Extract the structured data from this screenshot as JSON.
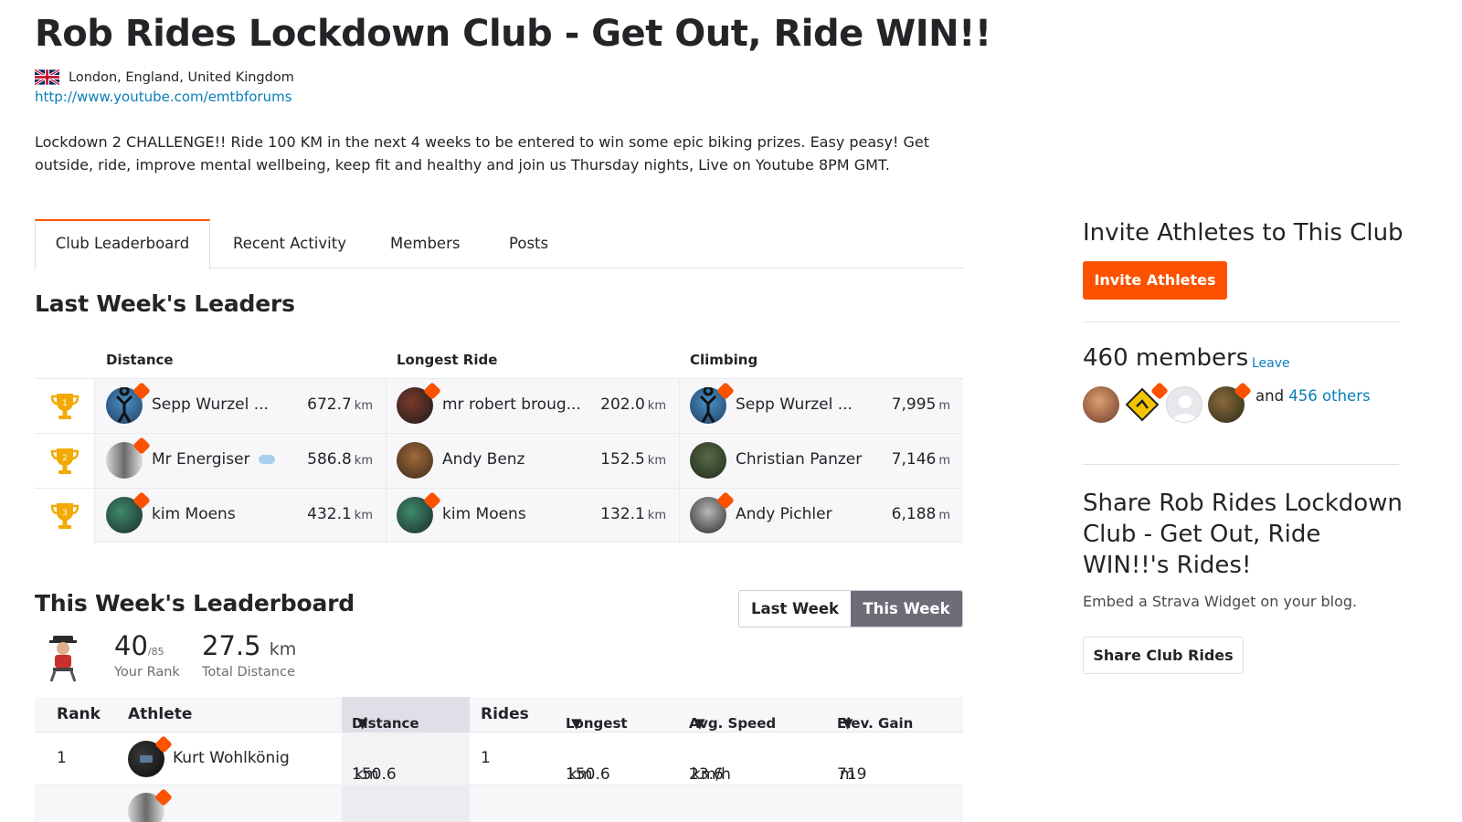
{
  "club": {
    "title": "Rob Rides Lockdown Club - Get Out, Ride WIN!!",
    "location": "London, England, United Kingdom",
    "url": "http://www.youtube.com/emtbforums",
    "description": "Lockdown 2 CHALLENGE!! Ride 100 KM in the next 4 weeks to be entered to win some epic biking prizes. Easy peasy! Get outside, ride, improve mental wellbeing, keep fit and healthy and join us Thursday nights, Live on Youtube 8PM GMT."
  },
  "tabs": [
    "Club Leaderboard",
    "Recent Activity",
    "Members",
    "Posts"
  ],
  "last_week": {
    "title": "Last Week's Leaders",
    "headers": [
      "Distance",
      "Longest Ride",
      "Climbing"
    ],
    "rows": [
      {
        "rank": "1",
        "distance": {
          "name": "Sepp Wurzel ...",
          "value": "672.7",
          "unit": "km"
        },
        "longest": {
          "name": "mr robert broug...",
          "value": "202.0",
          "unit": "km"
        },
        "climbing": {
          "name": "Sepp Wurzel ...",
          "value": "7,995",
          "unit": "m"
        }
      },
      {
        "rank": "2",
        "distance": {
          "name": "Mr Energiser",
          "value": "586.8",
          "unit": "km"
        },
        "longest": {
          "name": "Andy Benz",
          "value": "152.5",
          "unit": "km"
        },
        "climbing": {
          "name": "Christian Panzer",
          "value": "7,146",
          "unit": "m"
        }
      },
      {
        "rank": "3",
        "distance": {
          "name": "kim Moens",
          "value": "432.1",
          "unit": "km"
        },
        "longest": {
          "name": "kim Moens",
          "value": "132.1",
          "unit": "km"
        },
        "climbing": {
          "name": "Andy Pichler",
          "value": "6,188",
          "unit": "m"
        }
      }
    ]
  },
  "this_week": {
    "title": "This Week's Leaderboard",
    "toggle": [
      "Last Week",
      "This Week"
    ],
    "your_rank": "40",
    "rank_total": "/85",
    "your_rank_label": "Your Rank",
    "total_distance": "27.5",
    "total_distance_unit": "km",
    "total_distance_label": "Total Distance",
    "columns": [
      "Rank",
      "Athlete",
      "Distance",
      "Rides",
      "Longest",
      "Avg. Speed",
      "Elev. Gain"
    ],
    "rows": [
      {
        "rank": "1",
        "athlete": "Kurt Wohlkönig",
        "distance": "150.6",
        "distance_unit": "km",
        "rides": "1",
        "longest": "150.6",
        "longest_unit": "km",
        "speed": "23.6",
        "speed_unit": "km/h",
        "elev": "719",
        "elev_unit": "m"
      }
    ]
  },
  "sidebar": {
    "invite_title": "Invite Athletes to This Club",
    "invite_button": "Invite Athletes",
    "members_count": "460 members",
    "leave": "Leave",
    "and": "and",
    "others": "456 others",
    "share_title": "Share Rob Rides Lockdown Club - Get Out, Ride WIN!!'s Rides!",
    "embed_text": "Embed a Strava Widget on your blog.",
    "share_button": "Share Club Rides"
  },
  "colors": {
    "accent": "#fc5200",
    "link": "#0a7eb8",
    "trophy": "#f2a900"
  },
  "icons": [
    "uk-flag-icon",
    "trophy-icon",
    "sort-caret-icon",
    "subscriber-badge-icon",
    "cloud-icon"
  ]
}
